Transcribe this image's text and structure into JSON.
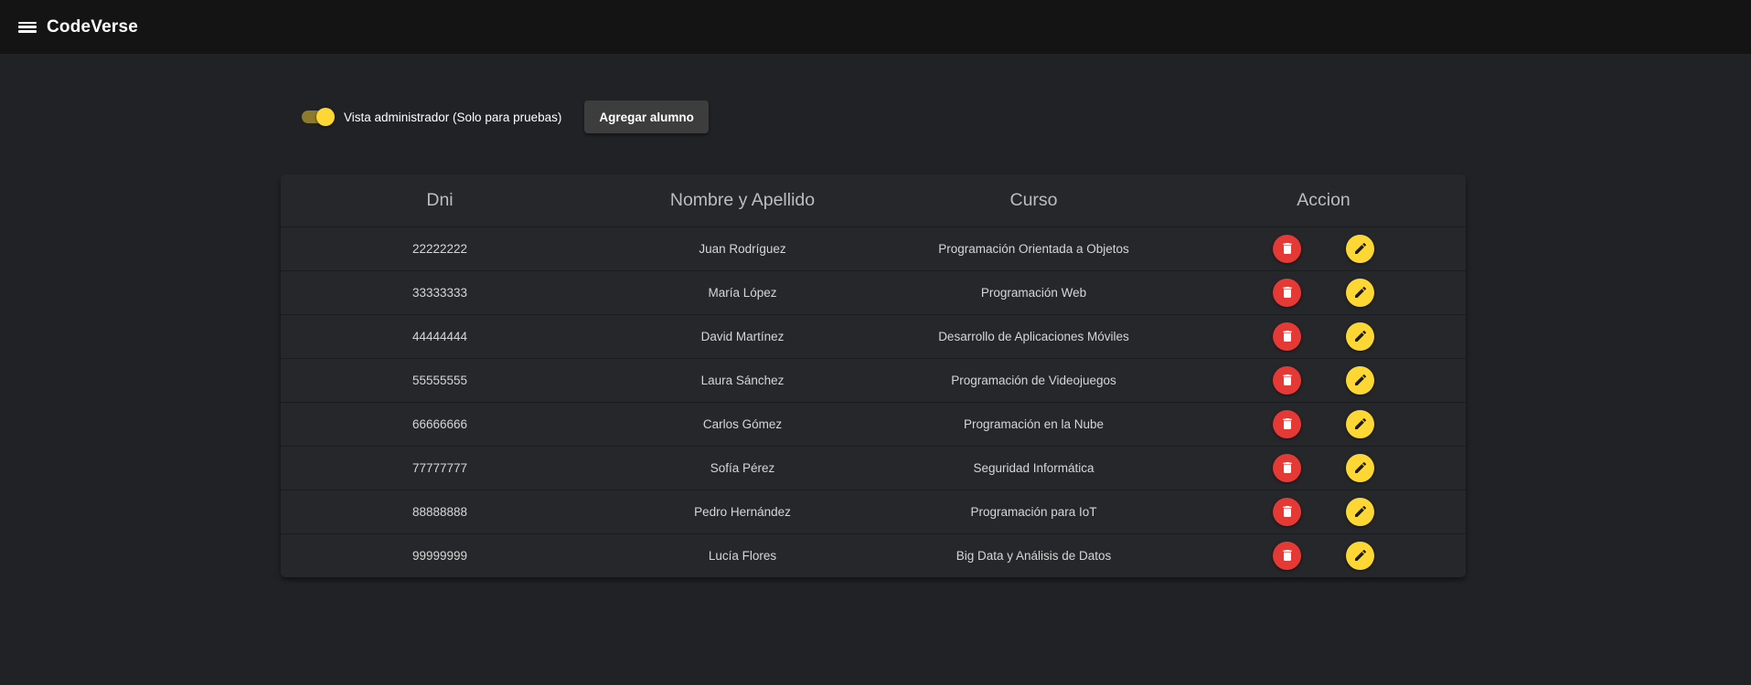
{
  "app": {
    "title": "CodeVerse",
    "menu_icon": "menu-icon"
  },
  "controls": {
    "admin_switch_label": "Vista administrador (Solo para pruebas)",
    "admin_switch_on": true,
    "add_button_label": "Agregar alumno"
  },
  "table": {
    "headers": [
      "Dni",
      "Nombre y Apellido",
      "Curso",
      "Accion"
    ],
    "rows": [
      {
        "dni": "22222222",
        "nombre": "Juan Rodríguez",
        "curso": "Programación Orientada a Objetos"
      },
      {
        "dni": "33333333",
        "nombre": "María López",
        "curso": "Programación Web"
      },
      {
        "dni": "44444444",
        "nombre": "David Martínez",
        "curso": "Desarrollo de Aplicaciones Móviles"
      },
      {
        "dni": "55555555",
        "nombre": "Laura Sánchez",
        "curso": "Programación de Videojuegos"
      },
      {
        "dni": "66666666",
        "nombre": "Carlos Gómez",
        "curso": "Programación en la Nube"
      },
      {
        "dni": "77777777",
        "nombre": "Sofía Pérez",
        "curso": "Seguridad Informática"
      },
      {
        "dni": "88888888",
        "nombre": "Pedro Hernández",
        "curso": "Programación para IoT"
      },
      {
        "dni": "99999999",
        "nombre": "Lucía Flores",
        "curso": "Big Data y Análisis de Datos"
      }
    ],
    "row_actions": {
      "delete_icon": "trash-icon",
      "edit_icon": "pencil-icon"
    }
  },
  "colors": {
    "background": "#212226",
    "topbar": "#141414",
    "delete_button": "#e53935",
    "edit_button": "#fdd835",
    "switch_on": "#fdd835"
  }
}
